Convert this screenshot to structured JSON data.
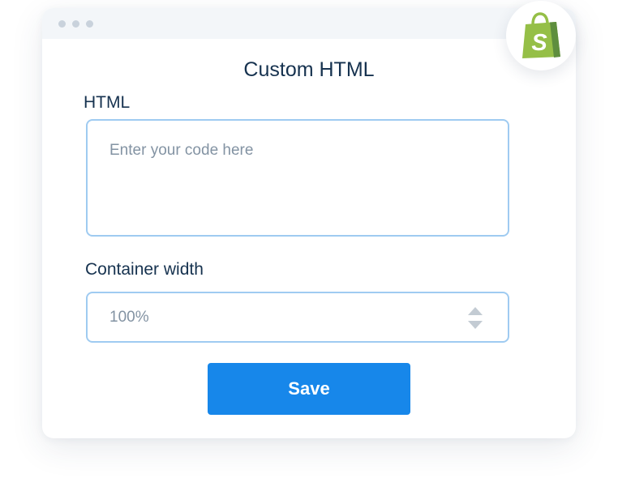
{
  "window": {
    "title": "Custom HTML"
  },
  "form": {
    "html_label": "HTML",
    "html_placeholder": "Enter your code here",
    "width_label": "Container width",
    "width_value": "100%"
  },
  "actions": {
    "save_label": "Save"
  },
  "brand": {
    "logo_icon": "shopify-bag-icon",
    "bag_color": "#95bf47",
    "bag_shade_color": "#5e8e3e"
  },
  "colors": {
    "accent": "#1787ea",
    "field_border": "#9fcbf1",
    "heading_text": "#16324f"
  }
}
